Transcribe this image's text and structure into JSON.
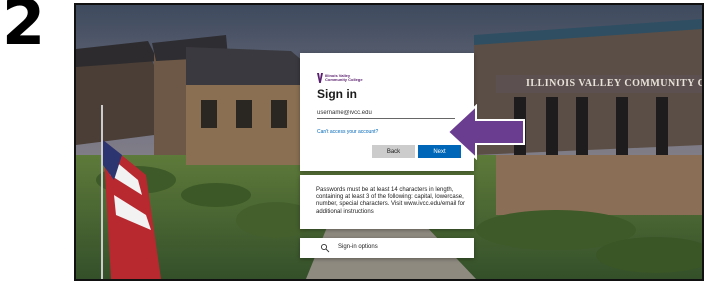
{
  "step": {
    "number": "2"
  },
  "background": {
    "building_sign": "ILLINOIS VALLEY COMMUNITY COLL"
  },
  "signin": {
    "logo_text_line1": "Illinois Valley",
    "logo_text_line2": "Community College",
    "title": "Sign in",
    "email_value": "username@ivcc.edu",
    "cant_access_link": "Can't access your account?",
    "back_label": "Back",
    "next_label": "Next"
  },
  "info": {
    "text": "Passwords must be at least 14 characters in length, containing at least 3 of the following: capital, lowercase, number, special characters. Visit www.ivcc.edu/email for additional instructions"
  },
  "options": {
    "label": "Sign-in options",
    "icon": "key-search-icon"
  },
  "colors": {
    "arrow": "#6a3d91",
    "next_button": "#0067b8",
    "link": "#0067b8",
    "logo": "#5a1f6e"
  }
}
